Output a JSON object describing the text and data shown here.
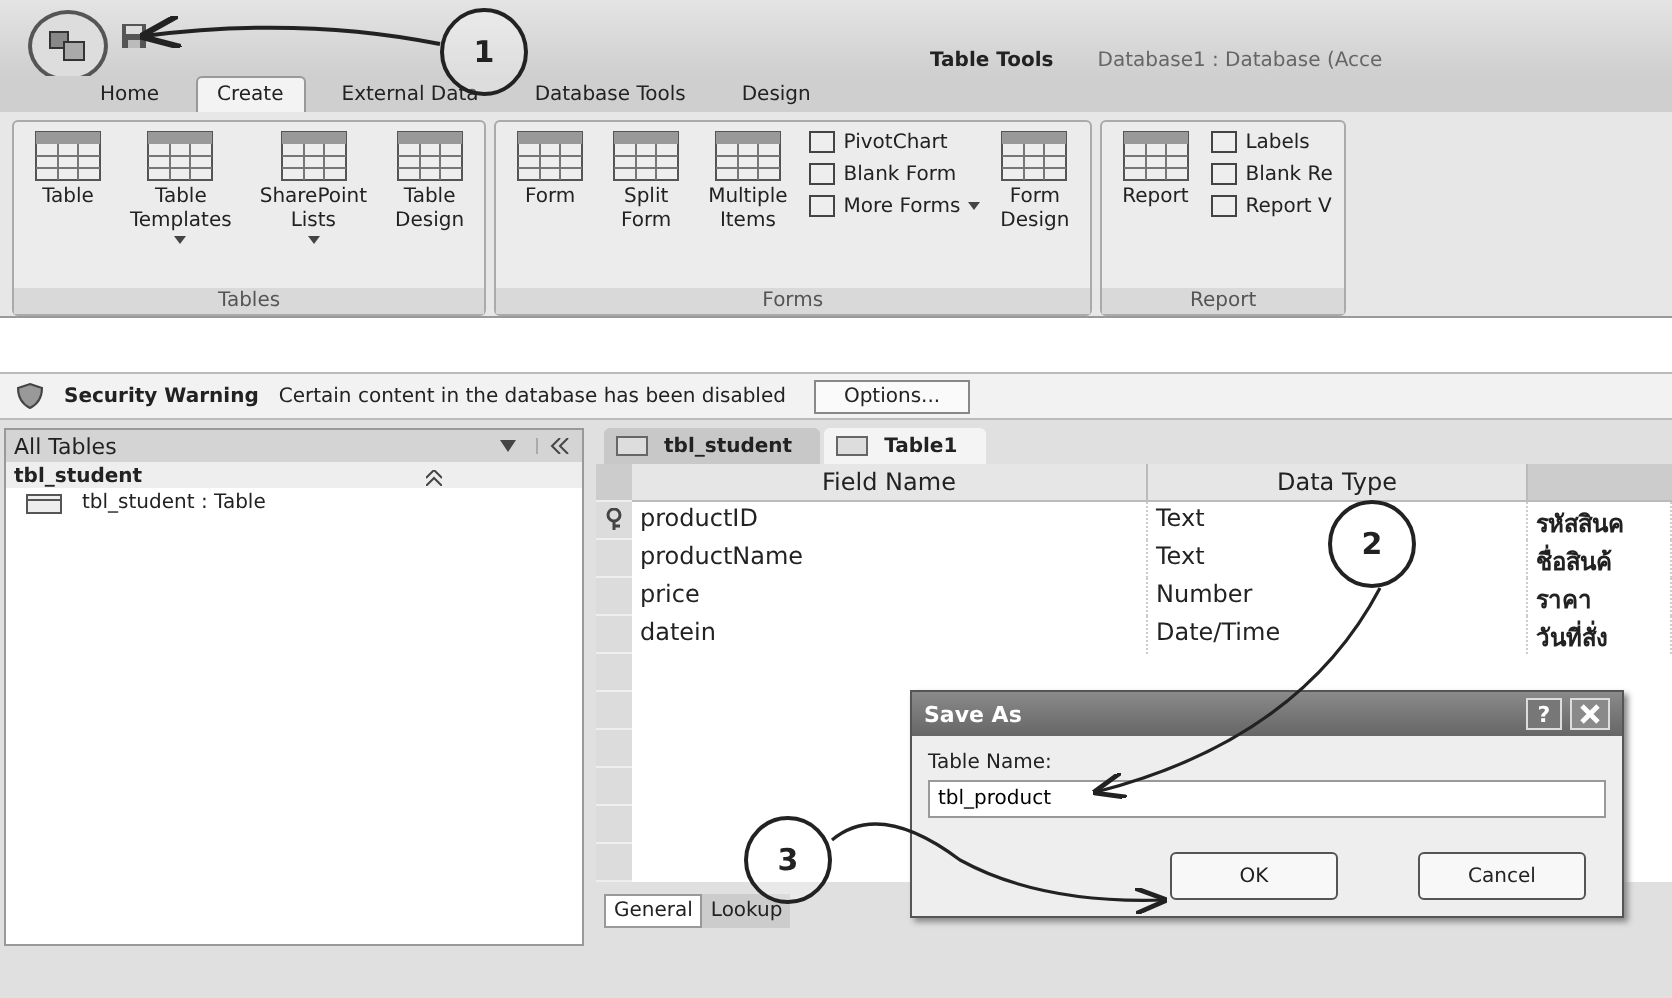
{
  "title_bar": {
    "contextual_tab": "Table Tools",
    "title": "Database1 : Database (Acce"
  },
  "ribbon_tabs": [
    {
      "label": "Home",
      "selected": false
    },
    {
      "label": "Create",
      "selected": true
    },
    {
      "label": "External Data",
      "selected": false
    },
    {
      "label": "Database Tools",
      "selected": false
    },
    {
      "label": "Design",
      "selected": false
    }
  ],
  "ribbon_groups": [
    {
      "label": "Tables",
      "items": [
        {
          "label": "Table",
          "kind": "large",
          "dropdown": false
        },
        {
          "label": "Table Templates",
          "kind": "large",
          "dropdown": true
        },
        {
          "label": "SharePoint Lists",
          "kind": "large",
          "dropdown": true
        },
        {
          "label": "Table Design",
          "kind": "large",
          "dropdown": false
        }
      ]
    },
    {
      "label": "Forms",
      "items": [
        {
          "label": "Form",
          "kind": "large",
          "dropdown": false
        },
        {
          "label": "Split Form",
          "kind": "large",
          "dropdown": false
        },
        {
          "label": "Multiple Items",
          "kind": "large",
          "dropdown": false
        },
        {
          "label": "PivotChart",
          "kind": "small",
          "dropdown": false
        },
        {
          "label": "Blank Form",
          "kind": "small",
          "dropdown": false
        },
        {
          "label": "More Forms",
          "kind": "small",
          "dropdown": true
        },
        {
          "label": "Form Design",
          "kind": "large",
          "dropdown": false
        }
      ]
    },
    {
      "label": "Report",
      "items": [
        {
          "label": "Report",
          "kind": "large",
          "dropdown": false
        },
        {
          "label": "Labels",
          "kind": "small",
          "dropdown": false
        },
        {
          "label": "Blank Re",
          "kind": "small",
          "dropdown": false
        },
        {
          "label": "Report V",
          "kind": "small",
          "dropdown": false
        }
      ]
    }
  ],
  "security_bar": {
    "title": "Security Warning",
    "message": "Certain content in the database has been disabled",
    "button": "Options..."
  },
  "nav_pane": {
    "header": "All Tables",
    "groups": [
      {
        "label": "tbl_student",
        "expanded": true,
        "children": [
          {
            "label": "tbl_student : Table"
          }
        ]
      }
    ]
  },
  "document_tabs": [
    {
      "label": "tbl_student",
      "selected": false
    },
    {
      "label": "Table1",
      "selected": true
    }
  ],
  "table": {
    "columns": [
      "Field Name",
      "Data Type"
    ],
    "rows": [
      {
        "field_name": "productID",
        "data_type": "Text",
        "description": "รหัสสินค",
        "primary_key": true
      },
      {
        "field_name": "productName",
        "data_type": "Text",
        "description": "ชื่อสินค้",
        "primary_key": false
      },
      {
        "field_name": "price",
        "data_type": "Number",
        "description": "ราคา",
        "primary_key": false
      },
      {
        "field_name": "datein",
        "data_type": "Date/Time",
        "description": "วันที่สั่ง",
        "primary_key": false
      }
    ]
  },
  "property_tabs": [
    {
      "label": "General",
      "selected": true
    },
    {
      "label": "Lookup",
      "selected": false
    }
  ],
  "dialog": {
    "title": "Save As",
    "help": "?",
    "field_label": "Table Name:",
    "value": "tbl_product",
    "buttons": [
      "OK",
      "Cancel"
    ]
  },
  "annotations": [
    {
      "label": "1"
    },
    {
      "label": "2"
    },
    {
      "label": "3"
    }
  ]
}
